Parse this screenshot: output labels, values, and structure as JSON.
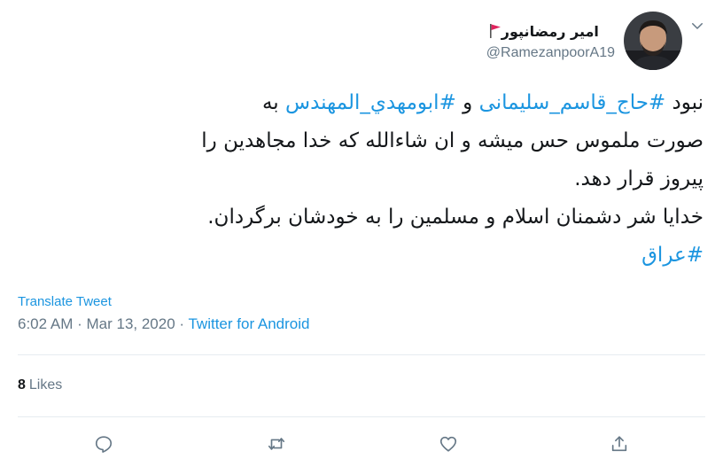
{
  "user": {
    "display_name": "امیر رمضانپور",
    "handle": "@RamezanpoorA19"
  },
  "tweet": {
    "line1_a": "نبود ",
    "line1_hashtag1": "#حاج_قاسم_سلیمانی",
    "line1_b": " و ",
    "line1_hashtag2": "#ابومهدي_المهندس",
    "line1_c": " به",
    "line2": "صورت ملموس حس میشه و ان شاءالله که خدا مجاهدین را",
    "line3": "پیروز قرار دهد.",
    "line4": "خدایا شر دشمنان اسلام و مسلمین را به خودشان برگردان.",
    "line5_hashtag": "#عراق"
  },
  "translate_label": "Translate Tweet",
  "meta": {
    "time": "6:02 AM",
    "sep1": " · ",
    "date": "Mar 13, 2020",
    "sep2": " · ",
    "source": "Twitter for Android"
  },
  "likes": {
    "count": "8",
    "label": "Likes"
  },
  "icons": {
    "menu": "chevron-down-icon",
    "reply": "reply-icon",
    "retweet": "retweet-icon",
    "like": "heart-icon",
    "share": "share-icon",
    "flag": "red-flag-icon"
  },
  "colors": {
    "link": "#1b95e0",
    "secondary": "#657786",
    "text": "#14171a",
    "flag": "#e0245e"
  }
}
